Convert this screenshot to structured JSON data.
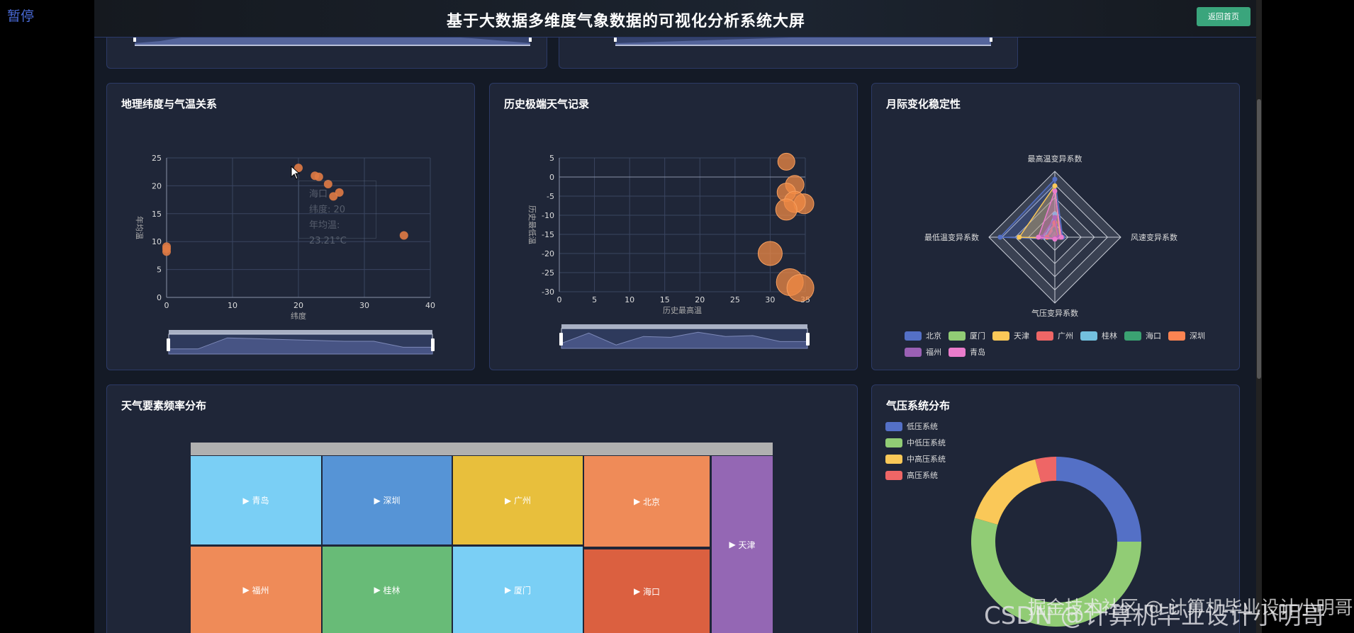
{
  "overlay": {
    "pause_label": "暂停"
  },
  "header": {
    "title": "基于大数据多维度气象数据的可视化分析系统大屏",
    "back_button": "返回首页"
  },
  "panels": {
    "latitude": {
      "title": "地理纬度与气温关系",
      "tooltip": {
        "city": "海口",
        "line1": "纬度: 20",
        "line2": "年均温: 23.21°C"
      }
    },
    "extreme": {
      "title": "历史极端天气记录"
    },
    "stability": {
      "title": "月际变化稳定性"
    },
    "frequency": {
      "title": "天气要素频率分布"
    },
    "pressure": {
      "title": "气压系统分布"
    }
  },
  "chart_data": [
    {
      "type": "scatter",
      "title": "地理纬度与气温关系",
      "xlabel": "纬度",
      "ylabel": "年均温",
      "xlim": [
        0,
        40
      ],
      "ylim": [
        0,
        25
      ],
      "xticks": [
        "0",
        "10",
        "20",
        "30",
        "40"
      ],
      "yticks": [
        "0",
        "5",
        "10",
        "15",
        "20",
        "25"
      ],
      "color": "#e07b45",
      "points": [
        [
          0,
          8.2
        ],
        [
          0,
          8.7
        ],
        [
          0,
          9.1
        ],
        [
          20,
          23.2
        ],
        [
          22.5,
          21.8
        ],
        [
          23.1,
          21.6
        ],
        [
          24.5,
          20.3
        ],
        [
          25.3,
          18.1
        ],
        [
          26.2,
          18.8
        ],
        [
          36,
          11.1
        ]
      ]
    },
    {
      "type": "scatter",
      "title": "历史极端天气记录",
      "xlabel": "历史最高温",
      "ylabel": "历史最低温",
      "xlim": [
        0,
        35
      ],
      "ylim": [
        -30,
        5
      ],
      "xticks": [
        "0",
        "5",
        "10",
        "15",
        "20",
        "25",
        "30",
        "35"
      ],
      "yticks": [
        "5",
        "0",
        "-5",
        "-10",
        "-15",
        "-20",
        "-25",
        "-30"
      ],
      "color": "#f08a44",
      "points": [
        [
          32.3,
          4,
          12
        ],
        [
          33.5,
          -2,
          13
        ],
        [
          32.3,
          -4,
          13
        ],
        [
          34.8,
          -7,
          14
        ],
        [
          33.5,
          -6.5,
          15
        ],
        [
          32.3,
          -8.5,
          15
        ],
        [
          30,
          -20,
          17
        ],
        [
          32.8,
          -27.5,
          19
        ],
        [
          34.3,
          -29,
          19
        ]
      ]
    },
    {
      "type": "radar",
      "title": "月际变化稳定性",
      "indicators": [
        "最高温变异系数",
        "风速变异系数",
        "气压变异系数",
        "最低温变异系数"
      ],
      "series": [
        {
          "name": "北京",
          "color": "#5470c6",
          "values": [
            0.88,
            0.12,
            0.03,
            0.83
          ]
        },
        {
          "name": "厦门",
          "color": "#91cc75",
          "values": [
            0.2,
            0.05,
            0.02,
            0.1
          ]
        },
        {
          "name": "天津",
          "color": "#fac858",
          "values": [
            0.78,
            0.08,
            0.02,
            0.54
          ]
        },
        {
          "name": "广州",
          "color": "#ee6666",
          "values": [
            0.15,
            0.05,
            0.02,
            0.1
          ]
        },
        {
          "name": "桂林",
          "color": "#73c0de",
          "values": [
            0.35,
            0.06,
            0.02,
            0.15
          ]
        },
        {
          "name": "海口",
          "color": "#3ba272",
          "values": [
            0.12,
            0.04,
            0.02,
            0.08
          ]
        },
        {
          "name": "深圳",
          "color": "#fc8452",
          "values": [
            0.22,
            0.05,
            0.02,
            0.12
          ]
        },
        {
          "name": "福州",
          "color": "#9a60b4",
          "values": [
            0.3,
            0.06,
            0.02,
            0.2
          ]
        },
        {
          "name": "青岛",
          "color": "#ea7ccc",
          "values": [
            0.7,
            0.1,
            0.03,
            0.25
          ]
        }
      ]
    },
    {
      "type": "treemap",
      "title": "天气要素频率分布",
      "items": [
        {
          "name": "青岛",
          "color": "#7acff5"
        },
        {
          "name": "深圳",
          "color": "#5694d6"
        },
        {
          "name": "广州",
          "color": "#e8bf3c"
        },
        {
          "name": "北京",
          "color": "#ef8b58"
        },
        {
          "name": "天津",
          "color": "#9467b4"
        },
        {
          "name": "福州",
          "color": "#ef8b58"
        },
        {
          "name": "桂林",
          "color": "#68bb77"
        },
        {
          "name": "厦门",
          "color": "#7acff5"
        },
        {
          "name": "海口",
          "color": "#db6040"
        }
      ]
    },
    {
      "type": "pie",
      "title": "气压系统分布",
      "slices": [
        {
          "name": "低压系统",
          "value": 25,
          "color": "#5470c6"
        },
        {
          "name": "中低压系统",
          "value": 54.5,
          "color": "#91cc75"
        },
        {
          "name": "中高压系统",
          "value": 16.5,
          "color": "#fac858"
        },
        {
          "name": "高压系统",
          "value": 4,
          "color": "#ee6666"
        }
      ]
    }
  ],
  "watermark": {
    "line1": "CSDN @计算机毕业设计小明哥",
    "line2": "掘金技术社区 @ 计算机毕业设计小明哥"
  }
}
